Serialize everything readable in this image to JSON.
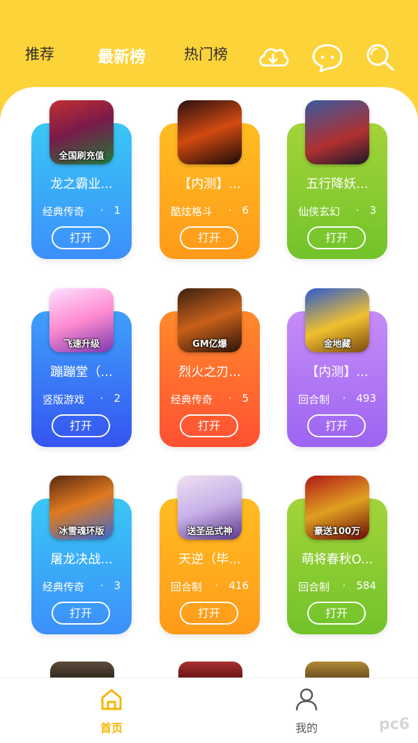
{
  "colors": {
    "header": "#fdd33a",
    "active_nav": "#f5b400",
    "inactive_nav": "#666666"
  },
  "top_nav": {
    "tabs": [
      {
        "label": "推荐"
      },
      {
        "label": "最新榜"
      },
      {
        "label": "热门榜"
      }
    ],
    "icons": [
      "download-cloud-icon",
      "chat-bubble-icon",
      "search-icon"
    ]
  },
  "games": [
    {
      "name": "龙之霸业...",
      "category": "经典传奇",
      "dot": "·",
      "count": "1",
      "thumb_text": "全国刷充值",
      "button": "打开"
    },
    {
      "name": "【内测】...",
      "category": "酷炫格斗",
      "dot": "·",
      "count": "6",
      "thumb_text": "",
      "button": "打开"
    },
    {
      "name": "五行降妖...",
      "category": "仙侠玄幻",
      "dot": "·",
      "count": "3",
      "thumb_text": "",
      "button": "打开"
    },
    {
      "name": "蹦蹦堂（...",
      "category": "竖版游戏",
      "dot": "·",
      "count": "2",
      "thumb_text": "飞速升级",
      "button": "打开"
    },
    {
      "name": "烈火之刃...",
      "category": "经典传奇",
      "dot": "·",
      "count": "5",
      "thumb_text": "GM亿爆",
      "button": "打开"
    },
    {
      "name": "【内测】...",
      "category": "回合制",
      "dot": "·",
      "count": "493",
      "thumb_text": "金地藏",
      "button": "打开"
    },
    {
      "name": "屠龙决战...",
      "category": "经典传奇",
      "dot": "·",
      "count": "3",
      "thumb_text": "冰雪魂环版",
      "button": "打开"
    },
    {
      "name": "天逆（毕...",
      "category": "回合制",
      "dot": "·",
      "count": "416",
      "thumb_text": "送圣品式神",
      "button": "打开"
    },
    {
      "name": "萌将春秋O...",
      "category": "回合制",
      "dot": "·",
      "count": "584",
      "thumb_text": "豪送100万",
      "button": "打开"
    }
  ],
  "bottom_nav": {
    "home_label": "首页",
    "mine_label": "我的"
  },
  "watermark": "pc6"
}
